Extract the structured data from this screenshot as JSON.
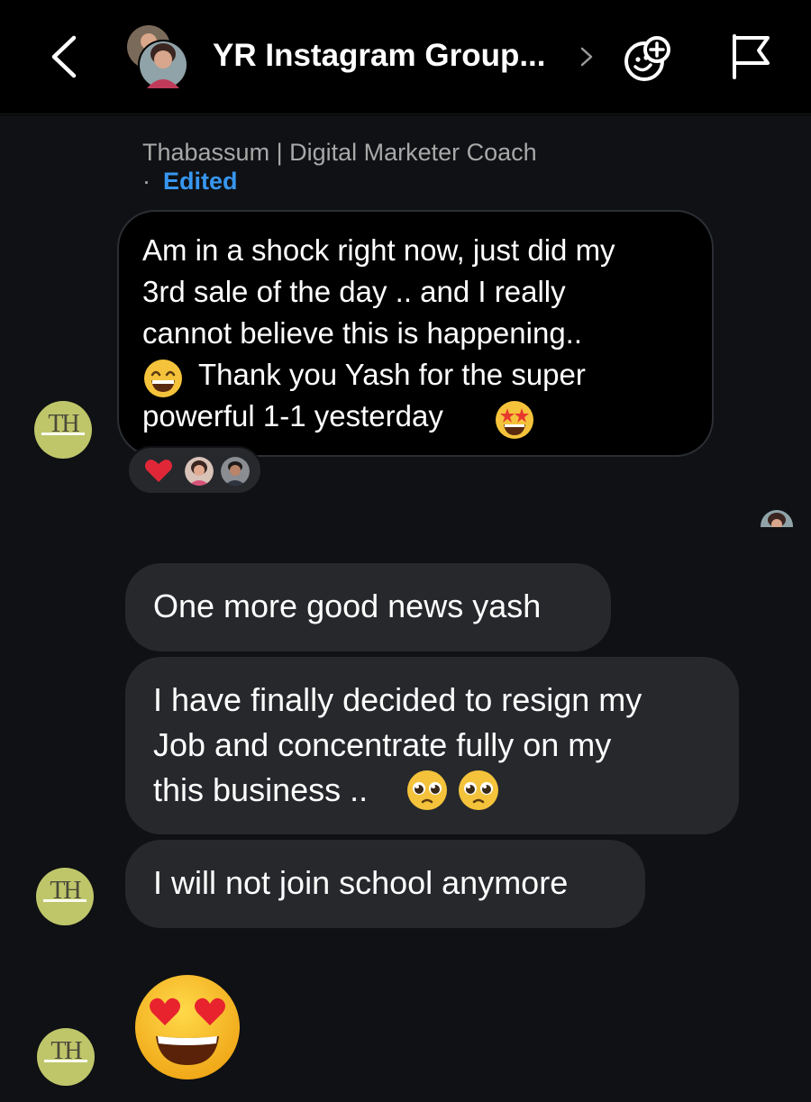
{
  "header": {
    "title": "YR Instagram Group...",
    "back_icon": "chevron-left-icon",
    "sticker_icon": "sticker-add-icon",
    "flag_icon": "flag-icon"
  },
  "messages": {
    "first": {
      "sender": "Thabassum | Digital Marketer Coach",
      "separator": "·",
      "edited_label": "Edited",
      "lines": [
        "Am in a shock right now, just did my",
        "3rd sale of the day .. and I really",
        "cannot believe this is happening..",
        "Thank you Yash for the super",
        "powerful 1-1 yesterday"
      ],
      "reaction": "heart"
    },
    "second": "One more good news yash",
    "third_lines": [
      "I have finally decided to resign my",
      "Job and concentrate fully on my",
      "this business .."
    ],
    "fourth": "I will not join school anymore"
  },
  "avatar_initials": "TH",
  "colors": {
    "accent": "#3797f0",
    "bubble_gray": "#26282c",
    "avatar_bg": "#bfc66a"
  }
}
